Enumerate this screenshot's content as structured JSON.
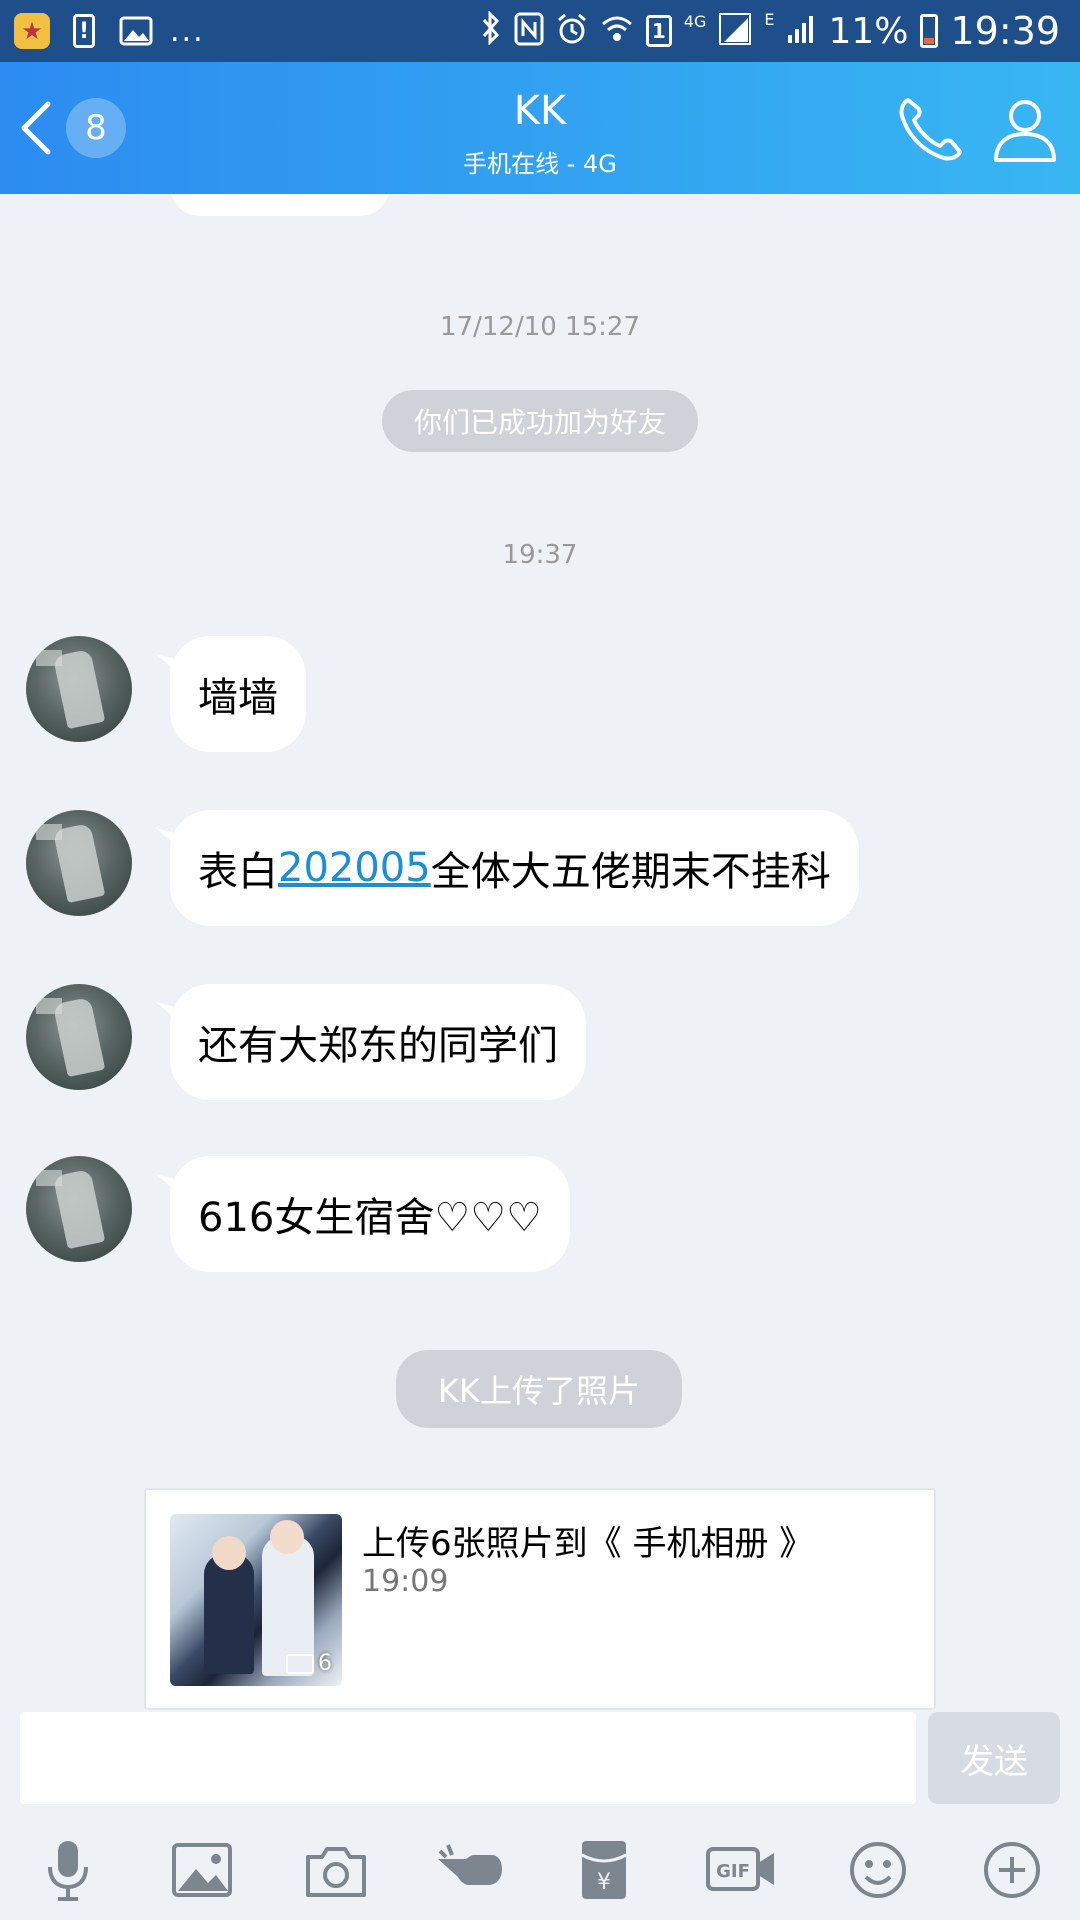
{
  "status_bar": {
    "more": "...",
    "network_type": "4G",
    "sim_indicator": "1",
    "edge_indicator": "E",
    "battery_percent": "11%",
    "time": "19:39"
  },
  "header": {
    "unread_count": "8",
    "title": "KK",
    "subtitle": "手机在线 - 4G"
  },
  "chat": {
    "timestamp_1": "17/12/10 15:27",
    "system_friend": "你们已成功加为好友",
    "timestamp_2": "19:37",
    "messages": [
      {
        "text": "墙墙"
      },
      {
        "prefix": "表白",
        "link": "202005",
        "suffix": "全体大五佬期末不挂科"
      },
      {
        "text": "还有大郑东的同学们"
      },
      {
        "text": "616女生宿舍♡♡♡"
      }
    ],
    "system_upload": "KK上传了照片",
    "album": {
      "title": "上传6张照片到《 手机相册 》",
      "time": "19:09",
      "photo_count": "6"
    }
  },
  "input": {
    "placeholder": "",
    "send_label": "发送"
  },
  "toolbar": {
    "icons": [
      "microphone-icon",
      "image-icon",
      "camera-icon",
      "poke-hand-icon",
      "red-envelope-icon",
      "gif-icon",
      "emoji-icon",
      "plus-icon"
    ]
  },
  "colors": {
    "header_start": "#2c8cf0",
    "header_end": "#38b6f2",
    "link": "#1a8fd8",
    "background": "#eef1f6"
  }
}
